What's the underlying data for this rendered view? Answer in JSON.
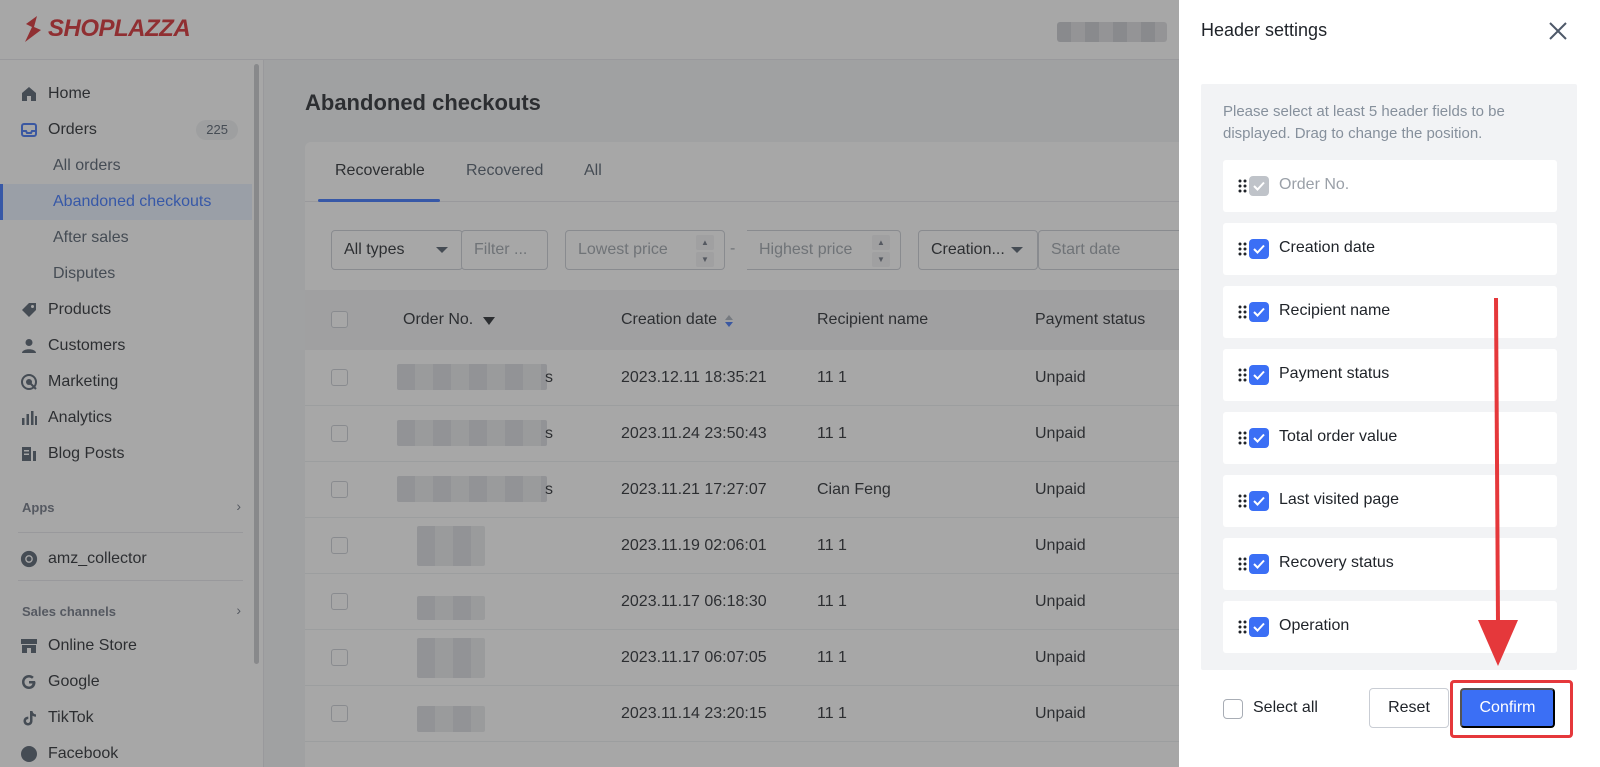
{
  "brand": {
    "name": "SHOPLAZZA",
    "color": "#d6252b"
  },
  "colors": {
    "primary": "#3b6ff5",
    "accent_red": "#e5383b",
    "overlay": "rgba(60,60,60,0.45)"
  },
  "sidebar": {
    "items": [
      {
        "label": "Home",
        "icon": "home-icon"
      },
      {
        "label": "Orders",
        "icon": "orders-icon",
        "badge": "225"
      },
      {
        "label": "All orders",
        "sub": true
      },
      {
        "label": "Abandoned checkouts",
        "sub": true,
        "active": true
      },
      {
        "label": "After sales",
        "sub": true
      },
      {
        "label": "Disputes",
        "sub": true
      },
      {
        "label": "Products",
        "icon": "tag-icon"
      },
      {
        "label": "Customers",
        "icon": "person-icon"
      },
      {
        "label": "Marketing",
        "icon": "marketing-icon"
      },
      {
        "label": "Analytics",
        "icon": "bar-chart-icon"
      },
      {
        "label": "Blog Posts",
        "icon": "blog-icon"
      }
    ],
    "apps_title": "Apps",
    "app_item": "amz_collector",
    "channels_title": "Sales channels",
    "channels": [
      {
        "label": "Online Store",
        "icon": "store-icon"
      },
      {
        "label": "Google",
        "icon": "google-icon"
      },
      {
        "label": "TikTok",
        "icon": "tiktok-icon"
      },
      {
        "label": "Facebook",
        "icon": "facebook-icon"
      }
    ]
  },
  "main": {
    "title": "Abandoned checkouts",
    "tabs": [
      "Recoverable",
      "Recovered",
      "All"
    ],
    "active_tab": "Recoverable",
    "filters": {
      "type": "All types",
      "filter_placeholder": "Filter ...",
      "lowest_price": "Lowest price",
      "range_sep": "-",
      "highest_price": "Highest price",
      "creation": "Creation...",
      "start_date": "Start date"
    },
    "columns": [
      "Order No.",
      "Creation date",
      "Recipient name",
      "Payment status"
    ],
    "rows": [
      {
        "order_suffix": "s",
        "date": "2023.12.11 18:35:21",
        "recipient": "11 1",
        "payment": "Unpaid"
      },
      {
        "order_suffix": "s",
        "date": "2023.11.24 23:50:43",
        "recipient": "11 1",
        "payment": "Unpaid"
      },
      {
        "order_suffix": "s",
        "date": "2023.11.21 17:27:07",
        "recipient": "Cian Feng",
        "payment": "Unpaid"
      },
      {
        "order_suffix": "",
        "date": "2023.11.19 02:06:01",
        "recipient": "11 1",
        "payment": "Unpaid"
      },
      {
        "order_suffix": "",
        "date": "2023.11.17 06:18:30",
        "recipient": "11 1",
        "payment": "Unpaid"
      },
      {
        "order_suffix": "",
        "date": "2023.11.17 06:07:05",
        "recipient": "11 1",
        "payment": "Unpaid"
      },
      {
        "order_suffix": "",
        "date": "2023.11.14 23:20:15",
        "recipient": "11 1",
        "payment": "Unpaid"
      }
    ]
  },
  "drawer": {
    "title": "Header settings",
    "hint": "Please select at least 5 header fields to be displayed. Drag to change the position.",
    "fields": [
      {
        "label": "Order No.",
        "checked": true,
        "disabled": true
      },
      {
        "label": "Creation date",
        "checked": true
      },
      {
        "label": "Recipient name",
        "checked": true
      },
      {
        "label": "Payment status",
        "checked": true
      },
      {
        "label": "Total order value",
        "checked": true
      },
      {
        "label": "Last visited page",
        "checked": true
      },
      {
        "label": "Recovery status",
        "checked": true
      },
      {
        "label": "Operation",
        "checked": true
      }
    ],
    "select_all": "Select all",
    "reset": "Reset",
    "confirm": "Confirm"
  }
}
